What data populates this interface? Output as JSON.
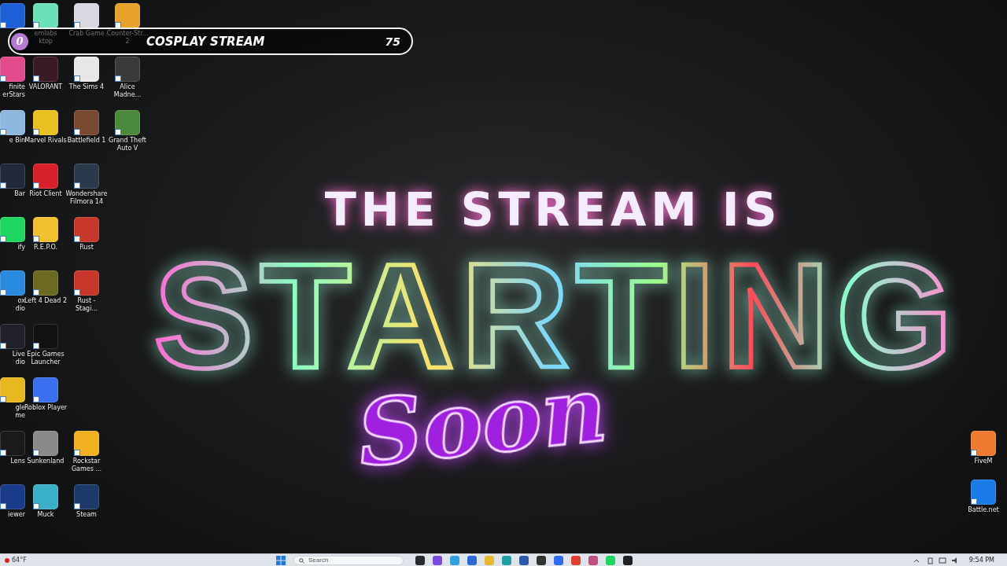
{
  "overlay_bar": {
    "badge": "0",
    "title": "COSPLAY STREAM",
    "count": "75"
  },
  "desktop_rows": [
    {
      "icons": [
        {
          "color": "#1c5fd6"
        },
        {
          "label_lines": [
            "emlabs",
            "ktop"
          ],
          "color": "#6ee0b8"
        },
        {
          "label_lines": [
            "Crab Game"
          ],
          "color": "#d8d8e0"
        },
        {
          "label_lines": [
            "Counter-Str...",
            "2"
          ],
          "color": "#e7a22b"
        }
      ]
    },
    {
      "icons": [
        {
          "label_lines": [
            "finite",
            "erStars"
          ],
          "color": "#e24a8a"
        },
        {
          "label_lines": [
            "VALORANT"
          ],
          "color": "#3a1a24"
        },
        {
          "label_lines": [
            "The Sims 4"
          ],
          "color": "#e8e8e8"
        },
        {
          "label_lines": [
            "Alice",
            "Madne..."
          ],
          "color": "#3a3a3a"
        }
      ]
    },
    {
      "icons": [
        {
          "label_lines": [
            "e Bin"
          ],
          "color": "#8fb8e0"
        },
        {
          "label_lines": [
            "Marvel Rivals"
          ],
          "color": "#e8c020"
        },
        {
          "label_lines": [
            "Battlefield 1"
          ],
          "color": "#7a4a30"
        },
        {
          "label_lines": [
            "Grand Theft",
            "Auto V"
          ],
          "color": "#4a8a3a"
        }
      ]
    },
    {
      "icons": [
        {
          "label_lines": [
            "Bar"
          ],
          "color": "#22283a"
        },
        {
          "label_lines": [
            "Riot Client"
          ],
          "color": "#d8202a"
        },
        {
          "label_lines": [
            "Wondershare",
            "Filmora 14"
          ],
          "color": "#2a3a4a"
        }
      ]
    },
    {
      "icons": [
        {
          "label_lines": [
            "ify"
          ],
          "color": "#1ed760"
        },
        {
          "label_lines": [
            "R.E.P.O."
          ],
          "color": "#f0c030"
        },
        {
          "label_lines": [
            "Rust"
          ],
          "color": "#c8382a"
        }
      ]
    },
    {
      "icons": [
        {
          "label_lines": [
            "ox",
            "dio"
          ],
          "color": "#2a8ae0"
        },
        {
          "label_lines": [
            "Left 4 Dead 2"
          ],
          "color": "#6a6a20"
        },
        {
          "label_lines": [
            "Rust -",
            "Stagi..."
          ],
          "color": "#c8382a"
        }
      ]
    },
    {
      "icons": [
        {
          "label_lines": [
            "Live",
            "dio"
          ],
          "color": "#202028"
        },
        {
          "label_lines": [
            "Epic Games",
            "Launcher"
          ],
          "color": "#111111"
        }
      ]
    },
    {
      "icons": [
        {
          "label_lines": [
            "gle",
            "me"
          ],
          "color": "#e8b820"
        },
        {
          "label_lines": [
            "Roblox Player"
          ],
          "color": "#3a6ff0"
        }
      ]
    },
    {
      "icons": [
        {
          "label_lines": [
            "Lens"
          ],
          "color": "#1a1a1a"
        },
        {
          "label_lines": [
            "Sunkenland"
          ],
          "color": "#8a8a88"
        },
        {
          "label_lines": [
            "Rockstar",
            "Games ..."
          ],
          "color": "#f0b020"
        }
      ]
    },
    {
      "icons": [
        {
          "label_lines": [
            "iewer"
          ],
          "color": "#1a3a8a"
        },
        {
          "label_lines": [
            "Muck"
          ],
          "color": "#3ab0c8"
        },
        {
          "label_lines": [
            "Steam"
          ],
          "color": "#1b3a6a"
        }
      ]
    }
  ],
  "right_icons": [
    {
      "label_lines": [
        "FiveM"
      ],
      "color": "#f07a30"
    },
    {
      "label_lines": [
        "Battle.net"
      ],
      "color": "#1a7ae8"
    }
  ],
  "sign": {
    "line_1": "THE STREAM IS",
    "line_2": "STARTING",
    "line_3": "Soon"
  },
  "taskbar": {
    "weather": "64°F",
    "search": {
      "placeholder": "Search"
    },
    "apps": [
      {
        "color": "#2a2a2a"
      },
      {
        "color": "#7a4ae0"
      },
      {
        "color": "#30a0e0"
      },
      {
        "color": "#2a6ad8"
      },
      {
        "color": "#e8b830"
      },
      {
        "color": "#20a0a0"
      },
      {
        "color": "#2a5aa8"
      },
      {
        "color": "#333333"
      },
      {
        "color": "#2d6cf0"
      },
      {
        "color": "#e04030"
      },
      {
        "color": "#c05080"
      },
      {
        "color": "#1ed760"
      },
      {
        "color": "#202020"
      }
    ],
    "time": "9:54 PM"
  }
}
